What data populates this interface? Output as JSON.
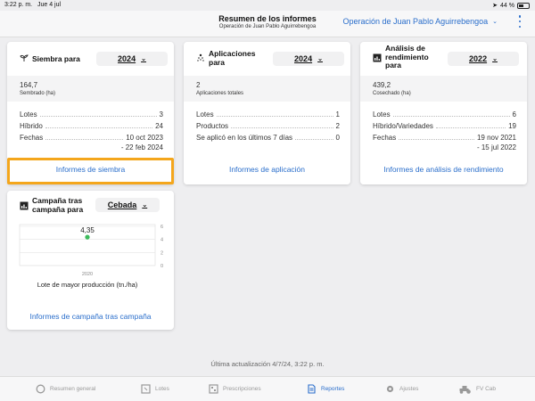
{
  "status": {
    "time": "3:22 p. m.",
    "date": "Jue 4 jul",
    "battery": "44 %"
  },
  "nav": {
    "title": "Resumen de los informes",
    "subtitle": "Operación de Juan Pablo Aguirrebengoa",
    "operation": "Operación de Juan Pablo Aguirrebengoa"
  },
  "siembra": {
    "title": "Siembra para",
    "year": "2024",
    "value": "164,7",
    "value_label": "Sembrado (ha)",
    "rows": [
      {
        "k": "Lotes",
        "v": "3"
      },
      {
        "k": "Híbrido",
        "v": "24"
      },
      {
        "k": "Fechas",
        "v": "10 oct 2023",
        "v2": "- 22 feb 2024"
      }
    ],
    "link": "Informes de siembra"
  },
  "aplicaciones": {
    "title": "Aplicaciones para",
    "year": "2024",
    "value": "2",
    "value_label": "Aplicaciones totales",
    "rows": [
      {
        "k": "Lotes",
        "v": "1"
      },
      {
        "k": "Productos",
        "v": "2"
      },
      {
        "k": "Se aplicó en los últimos 7 días",
        "v": "0"
      }
    ],
    "link": "Informes de aplicación"
  },
  "rendimiento": {
    "title": "Análisis de rendimiento para",
    "year": "2022",
    "value": "439,2",
    "value_label": "Cosechado (ha)",
    "rows": [
      {
        "k": "Lotes",
        "v": "6"
      },
      {
        "k": "Híbrido/Variedades",
        "v": "19"
      },
      {
        "k": "Fechas",
        "v": "19 nov 2021",
        "v2": "- 15 jul 2022"
      }
    ],
    "link": "Informes de análisis de rendimiento"
  },
  "campana": {
    "title": "Campaña tras campaña para",
    "crop": "Cebada",
    "link": "Informes de campaña tras campaña"
  },
  "chart_data": {
    "type": "scatter",
    "x": [
      "2020"
    ],
    "values": [
      4.35
    ],
    "point_label": "4,35",
    "xlabel": "Lote de mayor producción (tn./ha)",
    "ylim": [
      0,
      6
    ],
    "yticks": [
      "0",
      "2",
      "4",
      "6"
    ],
    "point_color": "#3dbb5c"
  },
  "footer": {
    "updated": "Última actualización 4/7/24, 3:22 p. m."
  },
  "tabs": [
    {
      "label": "Resumen general",
      "icon": "summary-icon"
    },
    {
      "label": "Lotes",
      "icon": "fields-icon"
    },
    {
      "label": "Prescripciones",
      "icon": "prescriptions-icon"
    },
    {
      "label": "Reportes",
      "icon": "reports-icon"
    },
    {
      "label": "Ajustes",
      "icon": "gear-icon"
    },
    {
      "label": "FV Cab",
      "icon": "tractor-icon"
    }
  ],
  "colors": {
    "accent": "#2a6ecb",
    "highlight": "#f4a61c"
  }
}
